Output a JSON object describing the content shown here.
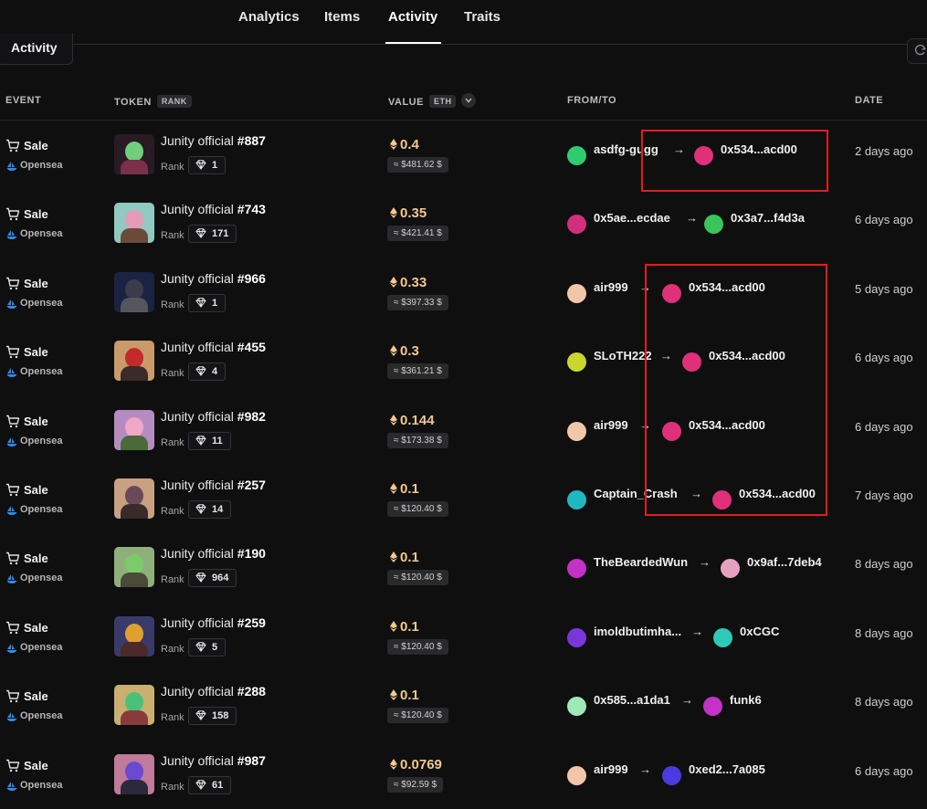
{
  "nav": {
    "tabs": [
      "Analytics",
      "Items",
      "Activity",
      "Traits"
    ],
    "active": "Activity"
  },
  "sub_tab": "Activity",
  "columns": {
    "event": "EVENT",
    "token": "TOKEN",
    "rank_badge": "RANK",
    "value": "VALUE",
    "eth_badge": "ETH",
    "from_to": "FROM/TO",
    "date": "DATE"
  },
  "rank_label": "Rank",
  "icons": {
    "cart": "cart-icon",
    "marketplace": "opensea-icon",
    "rank": "diamond-icon",
    "eth": "eth-icon",
    "refresh": "refresh-icon",
    "sort": "chevron-down-icon"
  },
  "colors": {
    "eth_value": "#f3c790",
    "highlight_box": "#e41c1c",
    "background": "#0f0f10"
  },
  "rows": [
    {
      "event": "Sale",
      "market": "Opensea",
      "token_name": "Junity official",
      "token_id": "#887",
      "rank": "1",
      "eth": "0.4",
      "usd": "≈ $481.62 $",
      "from": "asdfg-gugg",
      "to": "0x534...acd00",
      "date": "2 days ago",
      "from_color": "#2ecc71",
      "to_color": "#e0307a",
      "thumb_bg": "#2a1a24",
      "thumb_head": "#6fcf7a",
      "thumb_body": "#7a2f4a"
    },
    {
      "event": "Sale",
      "market": "Opensea",
      "token_name": "Junity official",
      "token_id": "#743",
      "rank": "171",
      "eth": "0.35",
      "usd": "≈ $421.41 $",
      "from": "0x5ae...ecdae",
      "to": "0x3a7...f4d3a",
      "date": "6 days ago",
      "from_color": "#d12f7c",
      "to_color": "#3ac45a",
      "thumb_bg": "#8fc9c0",
      "thumb_head": "#e39bb8",
      "thumb_body": "#6b4a3a"
    },
    {
      "event": "Sale",
      "market": "Opensea",
      "token_name": "Junity official",
      "token_id": "#966",
      "rank": "1",
      "eth": "0.33",
      "usd": "≈ $397.33 $",
      "from": "air999",
      "to": "0x534...acd00",
      "date": "5 days ago",
      "from_color": "#f2c6a8",
      "to_color": "#e0307a",
      "thumb_bg": "#1a2344",
      "thumb_head": "#3b3b4a",
      "thumb_body": "#555560"
    },
    {
      "event": "Sale",
      "market": "Opensea",
      "token_name": "Junity official",
      "token_id": "#455",
      "rank": "4",
      "eth": "0.3",
      "usd": "≈ $361.21 $",
      "from": "SLoTH222",
      "to": "0x534...acd00",
      "date": "6 days ago",
      "from_color": "#c8d62e",
      "to_color": "#e0307a",
      "thumb_bg": "#c99a6a",
      "thumb_head": "#c42a2a",
      "thumb_body": "#3a2a2a"
    },
    {
      "event": "Sale",
      "market": "Opensea",
      "token_name": "Junity official",
      "token_id": "#982",
      "rank": "11",
      "eth": "0.144",
      "usd": "≈ $173.38 $",
      "from": "air999",
      "to": "0x534...acd00",
      "date": "6 days ago",
      "from_color": "#f2c6a8",
      "to_color": "#e0307a",
      "thumb_bg": "#b58cc0",
      "thumb_head": "#f0a8c8",
      "thumb_body": "#4a6a3a"
    },
    {
      "event": "Sale",
      "market": "Opensea",
      "token_name": "Junity official",
      "token_id": "#257",
      "rank": "14",
      "eth": "0.1",
      "usd": "≈ $120.40 $",
      "from": "Captain_Crash",
      "to": "0x534...acd00",
      "date": "7 days ago",
      "from_color": "#1fb8c0",
      "to_color": "#e0307a",
      "thumb_bg": "#c9a080",
      "thumb_head": "#6a4a5a",
      "thumb_body": "#3a2a2a"
    },
    {
      "event": "Sale",
      "market": "Opensea",
      "token_name": "Junity official",
      "token_id": "#190",
      "rank": "964",
      "eth": "0.1",
      "usd": "≈ $120.40 $",
      "from": "TheBeardedWun",
      "to": "0x9af...7deb4",
      "date": "8 days ago",
      "from_color": "#c431c6",
      "to_color": "#e6a0c0",
      "thumb_bg": "#8fb07a",
      "thumb_head": "#7acb6a",
      "thumb_body": "#4a4a3a"
    },
    {
      "event": "Sale",
      "market": "Opensea",
      "token_name": "Junity official",
      "token_id": "#259",
      "rank": "5",
      "eth": "0.1",
      "usd": "≈ $120.40 $",
      "from": "imoldbutimha...",
      "to": "0xCGC",
      "date": "8 days ago",
      "from_color": "#7b36d9",
      "to_color": "#2ec9b8",
      "thumb_bg": "#3a3a6a",
      "thumb_head": "#e0a030",
      "thumb_body": "#4a2a2a"
    },
    {
      "event": "Sale",
      "market": "Opensea",
      "token_name": "Junity official",
      "token_id": "#288",
      "rank": "158",
      "eth": "0.1",
      "usd": "≈ $120.40 $",
      "from": "0x585...a1da1",
      "to": "funk6",
      "date": "8 days ago",
      "from_color": "#9fe8b8",
      "to_color": "#c431c6",
      "thumb_bg": "#c9b070",
      "thumb_head": "#4ac07a",
      "thumb_body": "#8a3a3a"
    },
    {
      "event": "Sale",
      "market": "Opensea",
      "token_name": "Junity official",
      "token_id": "#987",
      "rank": "61",
      "eth": "0.0769",
      "usd": "≈ $92.59 $",
      "from": "air999",
      "to": "0xed2...7a085",
      "date": "6 days ago",
      "from_color": "#f2c6a8",
      "to_color": "#4a3ae0",
      "thumb_bg": "#c07a9a",
      "thumb_head": "#6a4ad0",
      "thumb_body": "#2a2a3a"
    }
  ]
}
